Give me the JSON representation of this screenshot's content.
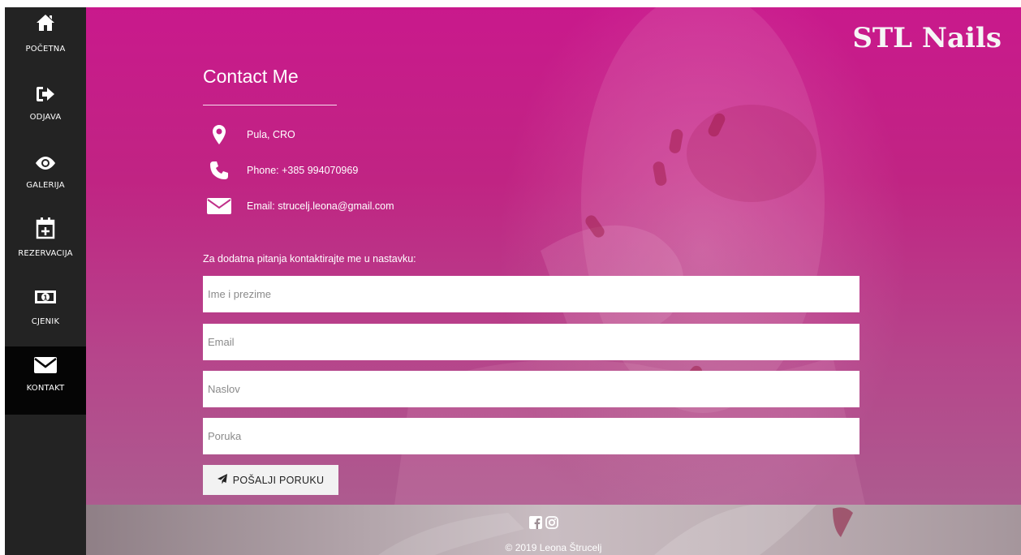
{
  "sidebar": {
    "items": [
      {
        "label": "POČETNA",
        "icon": "home-icon"
      },
      {
        "label": "ODJAVA",
        "icon": "sign-out-icon"
      },
      {
        "label": "GALERIJA",
        "icon": "eye-icon"
      },
      {
        "label": "REZERVACIJA",
        "icon": "calendar-plus-icon"
      },
      {
        "label": "CJENIK",
        "icon": "money-icon"
      },
      {
        "label": "KONTAKT",
        "icon": "envelope-icon",
        "active": true
      }
    ]
  },
  "brand": "STL Nails",
  "contact": {
    "title": "Contact Me",
    "location": "Pula, CRO",
    "phone": "Phone: +385 994070969",
    "email": "Email: strucelj.leona@gmail.com"
  },
  "form": {
    "intro": "Za dodatna pitanja kontaktirajte me u nastavku:",
    "name_placeholder": "Ime i prezime",
    "email_placeholder": "Email",
    "subject_placeholder": "Naslov",
    "message_placeholder": "Poruka",
    "submit_label": "POŠALJI PORUKU"
  },
  "footer": {
    "social": [
      "facebook-icon",
      "instagram-icon"
    ],
    "copyright": "© 2019 Leona Štrucelj"
  },
  "colors": {
    "sidebar": "#232323",
    "sidebar_active": "#050505",
    "accent": "#c9198c"
  }
}
